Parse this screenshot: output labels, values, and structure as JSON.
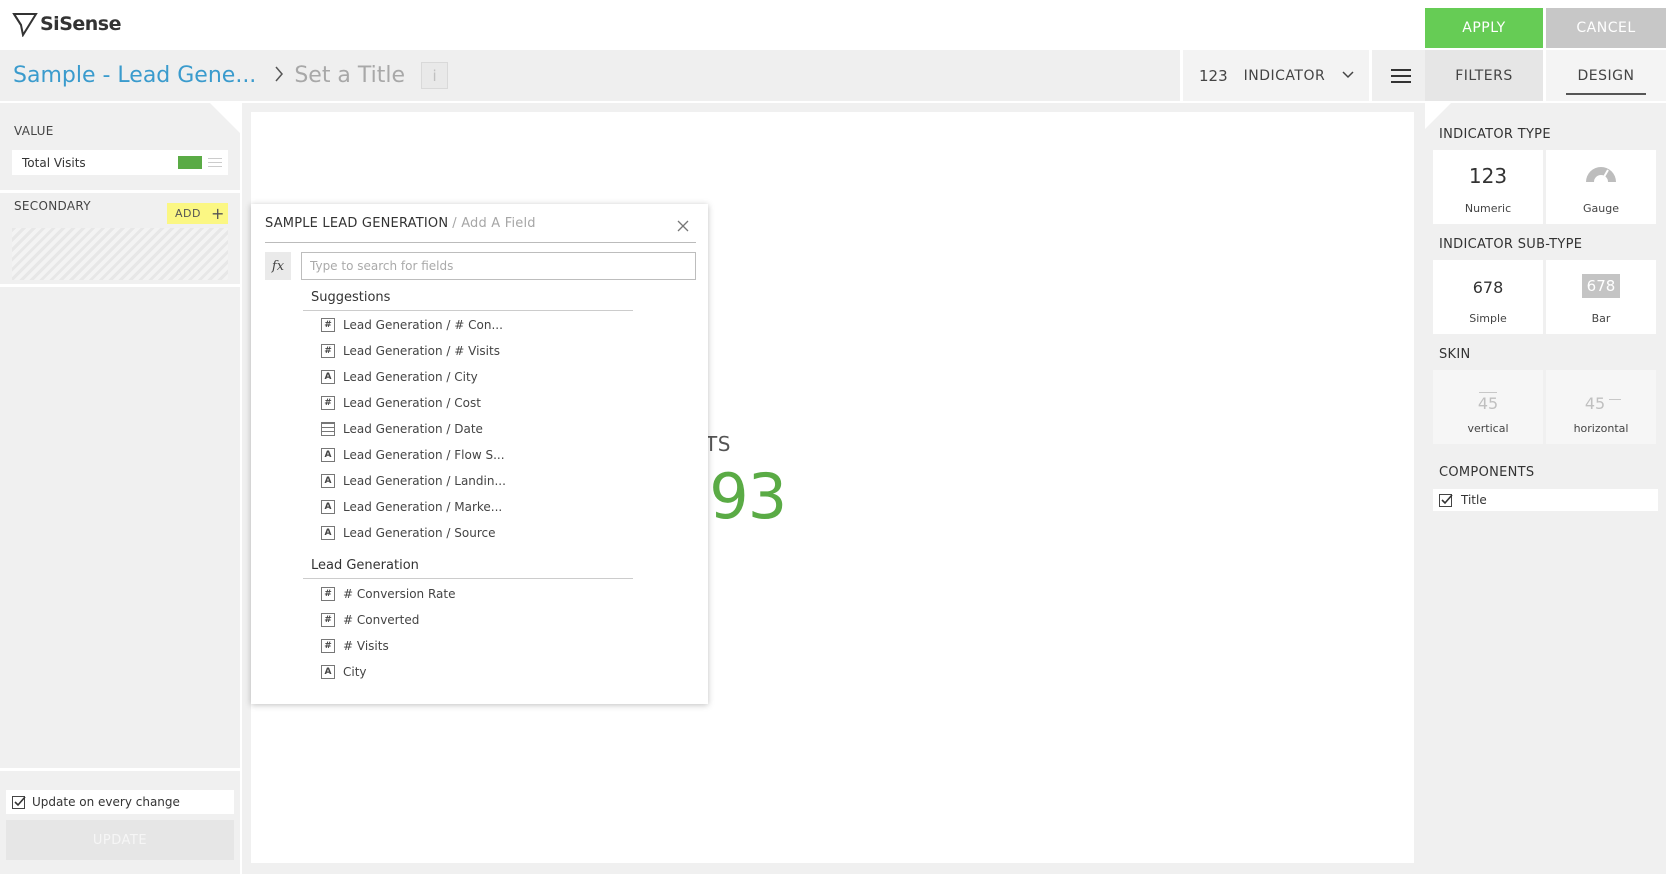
{
  "app": {
    "logo_text": "SiSense"
  },
  "header": {
    "apply_label": "APPLY",
    "cancel_label": "CANCEL"
  },
  "toolbar": {
    "datasource": "Sample - Lead Gene...",
    "widget_title_placeholder": "Set a Title",
    "info_icon": "i",
    "widget_type_num": "123",
    "widget_type_label": "INDICATOR",
    "tab_filters": "FILTERS",
    "tab_design": "DESIGN"
  },
  "left_panel": {
    "value_label": "VALUE",
    "value_item": "Total Visits",
    "value_color": "#5aab45",
    "secondary_label": "SECONDARY",
    "add_label": "ADD",
    "update_checkbox_label": "Update on every change",
    "update_button": "UPDATE"
  },
  "indicator": {
    "title": "TOTAL VISITS",
    "value": "379,893",
    "color": "#5aab45"
  },
  "field_popup": {
    "title": "SAMPLE LEAD GENERATION",
    "subtitle": "/ Add A Field",
    "fx_label": "fx",
    "search_placeholder": "Type to search for fields",
    "suggestions_header": "Suggestions",
    "suggestions": [
      {
        "icon": "#",
        "label": "Lead Generation / # Con..."
      },
      {
        "icon": "#",
        "label": "Lead Generation / # Visits"
      },
      {
        "icon": "A",
        "label": "Lead Generation / City"
      },
      {
        "icon": "#",
        "label": "Lead Generation / Cost"
      },
      {
        "icon": "calendar",
        "label": "Lead Generation / Date"
      },
      {
        "icon": "A",
        "label": "Lead Generation / Flow S..."
      },
      {
        "icon": "A",
        "label": "Lead Generation / Landin..."
      },
      {
        "icon": "A",
        "label": "Lead Generation / Marke..."
      },
      {
        "icon": "A",
        "label": "Lead Generation / Source"
      }
    ],
    "table_header": "Lead Generation",
    "table_fields": [
      {
        "icon": "#",
        "label": "# Conversion Rate"
      },
      {
        "icon": "#",
        "label": "# Converted"
      },
      {
        "icon": "#",
        "label": "# Visits"
      },
      {
        "icon": "A",
        "label": "City"
      }
    ]
  },
  "design_panel": {
    "indicator_type_label": "INDICATOR TYPE",
    "types": [
      {
        "big": "123",
        "caption": "Numeric"
      },
      {
        "big": "",
        "caption": "Gauge"
      }
    ],
    "subtype_label": "INDICATOR SUB-TYPE",
    "subtypes": [
      {
        "big": "678",
        "caption": "Simple"
      },
      {
        "big": "678",
        "caption": "Bar"
      }
    ],
    "skin_label": "SKIN",
    "skins": [
      {
        "big": "45",
        "caption": "vertical"
      },
      {
        "big": "45",
        "caption": "horizontal"
      }
    ],
    "components_label": "COMPONENTS",
    "component_title": "Title"
  },
  "colors": {
    "apply": "#66cc55",
    "cancel": "#c7c7c7",
    "accent_blue": "#3a9bcd",
    "add_highlight": "#fbf783"
  }
}
